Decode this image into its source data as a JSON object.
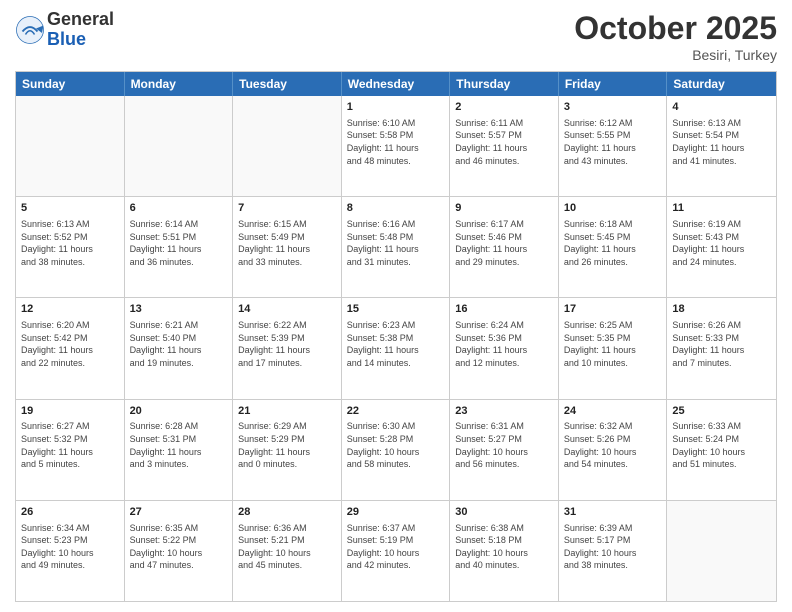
{
  "logo": {
    "general": "General",
    "blue": "Blue"
  },
  "title": "October 2025",
  "location": "Besiri, Turkey",
  "days": [
    "Sunday",
    "Monday",
    "Tuesday",
    "Wednesday",
    "Thursday",
    "Friday",
    "Saturday"
  ],
  "weeks": [
    [
      {
        "day": "",
        "text": ""
      },
      {
        "day": "",
        "text": ""
      },
      {
        "day": "",
        "text": ""
      },
      {
        "day": "1",
        "text": "Sunrise: 6:10 AM\nSunset: 5:58 PM\nDaylight: 11 hours\nand 48 minutes."
      },
      {
        "day": "2",
        "text": "Sunrise: 6:11 AM\nSunset: 5:57 PM\nDaylight: 11 hours\nand 46 minutes."
      },
      {
        "day": "3",
        "text": "Sunrise: 6:12 AM\nSunset: 5:55 PM\nDaylight: 11 hours\nand 43 minutes."
      },
      {
        "day": "4",
        "text": "Sunrise: 6:13 AM\nSunset: 5:54 PM\nDaylight: 11 hours\nand 41 minutes."
      }
    ],
    [
      {
        "day": "5",
        "text": "Sunrise: 6:13 AM\nSunset: 5:52 PM\nDaylight: 11 hours\nand 38 minutes."
      },
      {
        "day": "6",
        "text": "Sunrise: 6:14 AM\nSunset: 5:51 PM\nDaylight: 11 hours\nand 36 minutes."
      },
      {
        "day": "7",
        "text": "Sunrise: 6:15 AM\nSunset: 5:49 PM\nDaylight: 11 hours\nand 33 minutes."
      },
      {
        "day": "8",
        "text": "Sunrise: 6:16 AM\nSunset: 5:48 PM\nDaylight: 11 hours\nand 31 minutes."
      },
      {
        "day": "9",
        "text": "Sunrise: 6:17 AM\nSunset: 5:46 PM\nDaylight: 11 hours\nand 29 minutes."
      },
      {
        "day": "10",
        "text": "Sunrise: 6:18 AM\nSunset: 5:45 PM\nDaylight: 11 hours\nand 26 minutes."
      },
      {
        "day": "11",
        "text": "Sunrise: 6:19 AM\nSunset: 5:43 PM\nDaylight: 11 hours\nand 24 minutes."
      }
    ],
    [
      {
        "day": "12",
        "text": "Sunrise: 6:20 AM\nSunset: 5:42 PM\nDaylight: 11 hours\nand 22 minutes."
      },
      {
        "day": "13",
        "text": "Sunrise: 6:21 AM\nSunset: 5:40 PM\nDaylight: 11 hours\nand 19 minutes."
      },
      {
        "day": "14",
        "text": "Sunrise: 6:22 AM\nSunset: 5:39 PM\nDaylight: 11 hours\nand 17 minutes."
      },
      {
        "day": "15",
        "text": "Sunrise: 6:23 AM\nSunset: 5:38 PM\nDaylight: 11 hours\nand 14 minutes."
      },
      {
        "day": "16",
        "text": "Sunrise: 6:24 AM\nSunset: 5:36 PM\nDaylight: 11 hours\nand 12 minutes."
      },
      {
        "day": "17",
        "text": "Sunrise: 6:25 AM\nSunset: 5:35 PM\nDaylight: 11 hours\nand 10 minutes."
      },
      {
        "day": "18",
        "text": "Sunrise: 6:26 AM\nSunset: 5:33 PM\nDaylight: 11 hours\nand 7 minutes."
      }
    ],
    [
      {
        "day": "19",
        "text": "Sunrise: 6:27 AM\nSunset: 5:32 PM\nDaylight: 11 hours\nand 5 minutes."
      },
      {
        "day": "20",
        "text": "Sunrise: 6:28 AM\nSunset: 5:31 PM\nDaylight: 11 hours\nand 3 minutes."
      },
      {
        "day": "21",
        "text": "Sunrise: 6:29 AM\nSunset: 5:29 PM\nDaylight: 11 hours\nand 0 minutes."
      },
      {
        "day": "22",
        "text": "Sunrise: 6:30 AM\nSunset: 5:28 PM\nDaylight: 10 hours\nand 58 minutes."
      },
      {
        "day": "23",
        "text": "Sunrise: 6:31 AM\nSunset: 5:27 PM\nDaylight: 10 hours\nand 56 minutes."
      },
      {
        "day": "24",
        "text": "Sunrise: 6:32 AM\nSunset: 5:26 PM\nDaylight: 10 hours\nand 54 minutes."
      },
      {
        "day": "25",
        "text": "Sunrise: 6:33 AM\nSunset: 5:24 PM\nDaylight: 10 hours\nand 51 minutes."
      }
    ],
    [
      {
        "day": "26",
        "text": "Sunrise: 6:34 AM\nSunset: 5:23 PM\nDaylight: 10 hours\nand 49 minutes."
      },
      {
        "day": "27",
        "text": "Sunrise: 6:35 AM\nSunset: 5:22 PM\nDaylight: 10 hours\nand 47 minutes."
      },
      {
        "day": "28",
        "text": "Sunrise: 6:36 AM\nSunset: 5:21 PM\nDaylight: 10 hours\nand 45 minutes."
      },
      {
        "day": "29",
        "text": "Sunrise: 6:37 AM\nSunset: 5:19 PM\nDaylight: 10 hours\nand 42 minutes."
      },
      {
        "day": "30",
        "text": "Sunrise: 6:38 AM\nSunset: 5:18 PM\nDaylight: 10 hours\nand 40 minutes."
      },
      {
        "day": "31",
        "text": "Sunrise: 6:39 AM\nSunset: 5:17 PM\nDaylight: 10 hours\nand 38 minutes."
      },
      {
        "day": "",
        "text": ""
      }
    ]
  ]
}
